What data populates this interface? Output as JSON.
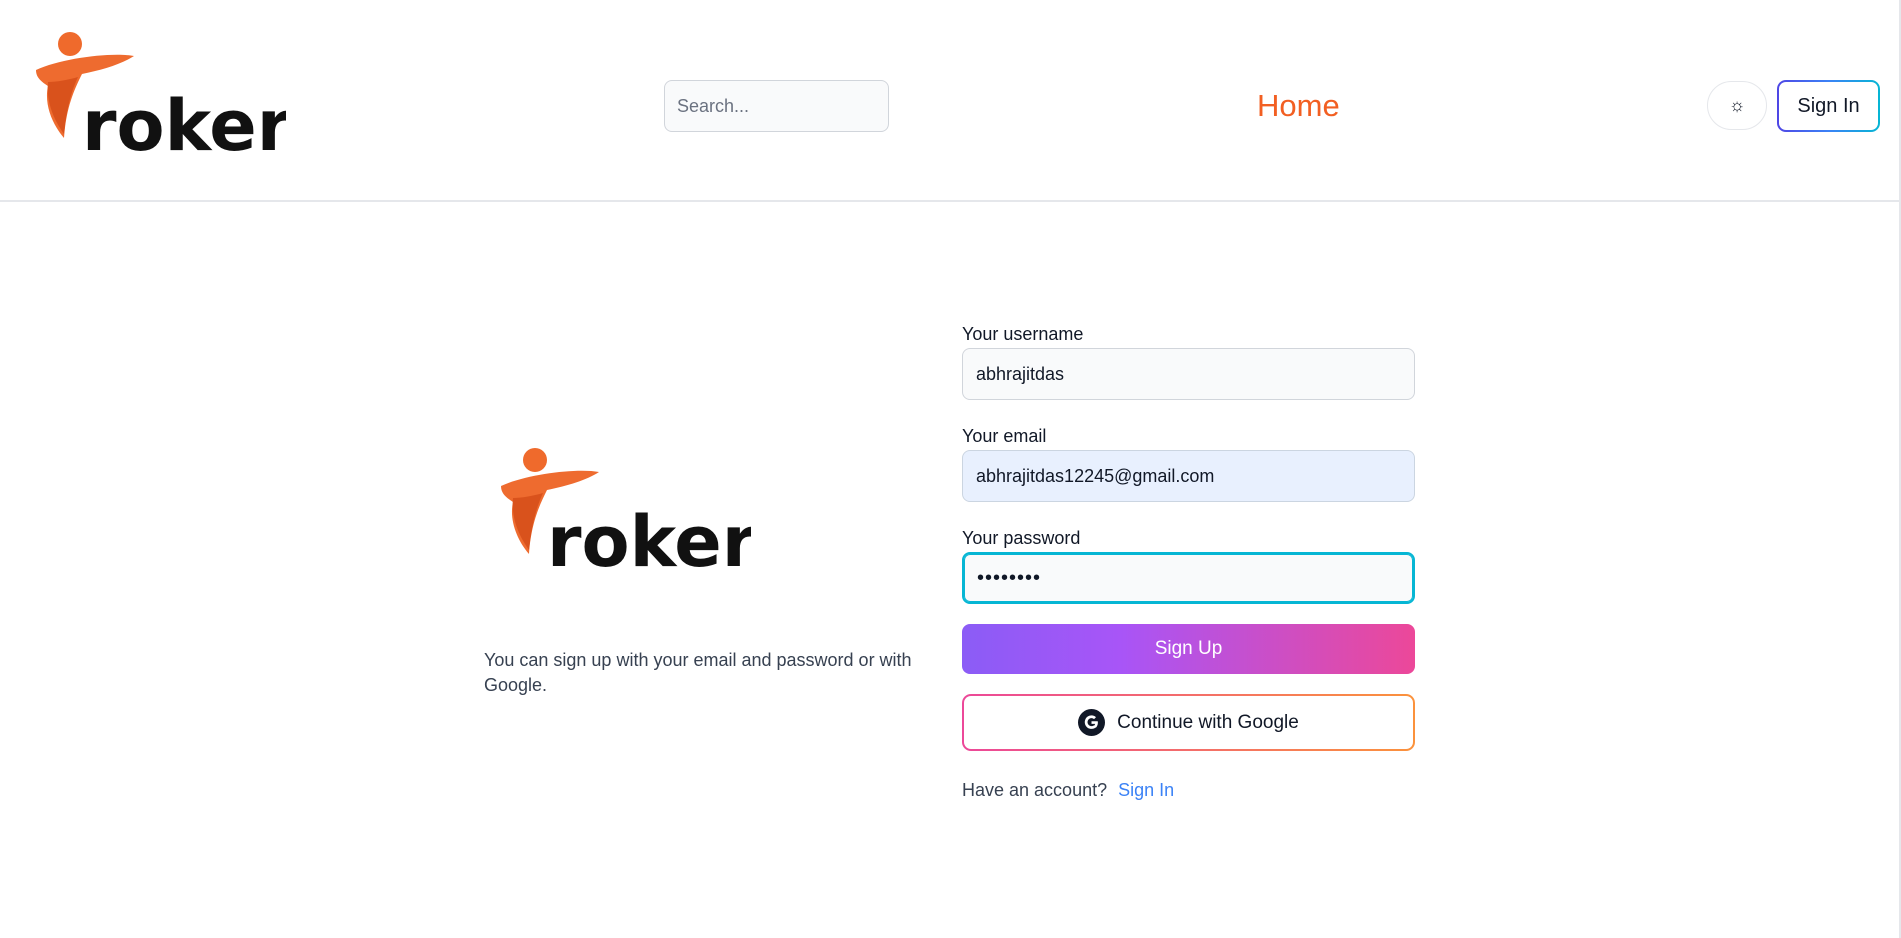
{
  "header": {
    "logo_text": "roker",
    "search_placeholder": "Search...",
    "home_label": "Home",
    "theme_toggle_glyph": "☼",
    "signin_label": "Sign In"
  },
  "hero": {
    "logo_text": "roker",
    "description": "You can sign up with your email and password or with Google."
  },
  "form": {
    "username_label": "Your username",
    "username_value": "abhrajitdas",
    "email_label": "Your email",
    "email_value": "abhrajitdas12245@gmail.com",
    "password_label": "Your password",
    "password_masked": "••••••••",
    "signup_label": "Sign Up",
    "google_label": "Continue with Google",
    "have_account_text": "Have an account?",
    "signin_link": "Sign In"
  },
  "colors": {
    "brand_orange": "#f25f22",
    "focus_ring": "#06b6d4",
    "signup_gradient_start": "#8b5cf6",
    "signup_gradient_end": "#ec4899",
    "link": "#3b82f6"
  }
}
